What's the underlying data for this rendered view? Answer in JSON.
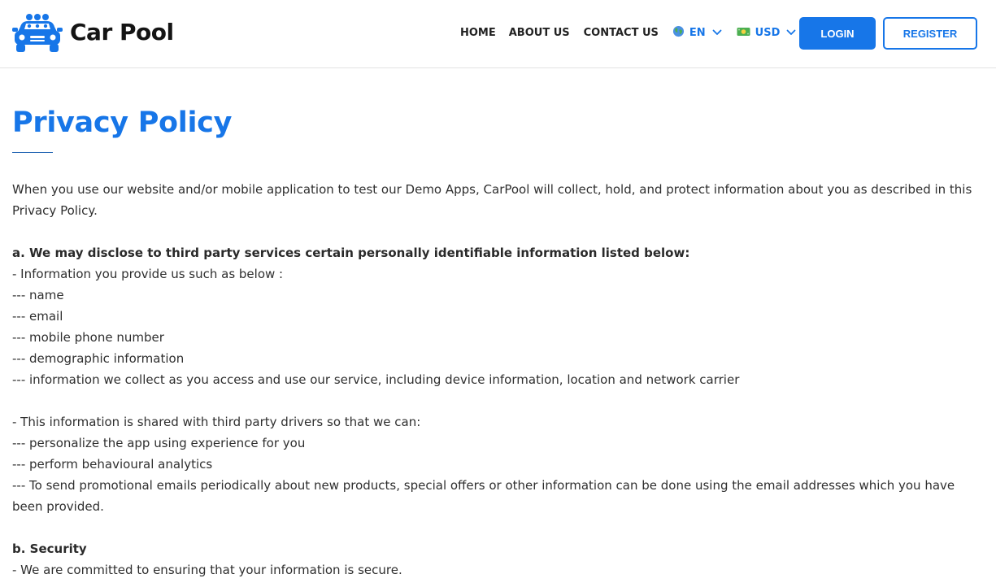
{
  "brand": {
    "name": "Car Pool"
  },
  "nav": {
    "home": "HOME",
    "about": "ABOUT US",
    "contact": "CONTACT US",
    "language": {
      "label": "EN",
      "icon": "globe-icon"
    },
    "currency": {
      "label": "USD",
      "icon": "banknote-icon"
    }
  },
  "auth": {
    "login": "LOGIN",
    "register": "REGISTER"
  },
  "colors": {
    "accent": "#1776e8",
    "text": "#2f2f2f"
  },
  "page": {
    "title": "Privacy Policy",
    "intro": "When you use our website and/or mobile application to test our Demo Apps, CarPool will collect, hold, and protect information about you as described in this Privacy Policy.",
    "section_a": {
      "heading": "a. We may disclose to third party services certain personally identifiable information listed below:",
      "intro": "- Information you provide us such as below :",
      "items": [
        "--- name",
        "--- email",
        "--- mobile phone number",
        "--- demographic information",
        "--- information we collect as you access and use our service, including device information, location and network carrier"
      ],
      "shared_intro": "- This information is shared with third party drivers so that we can:",
      "shared_items": [
        "--- personalize the app using experience for you",
        "--- perform behavioural analytics",
        "--- To send promotional emails periodically about new products, special offers or other information can be done using the email addresses which you have been provided."
      ]
    },
    "section_b": {
      "heading": "b. Security",
      "line1": "- We are committed to ensuring that your information is secure."
    }
  }
}
